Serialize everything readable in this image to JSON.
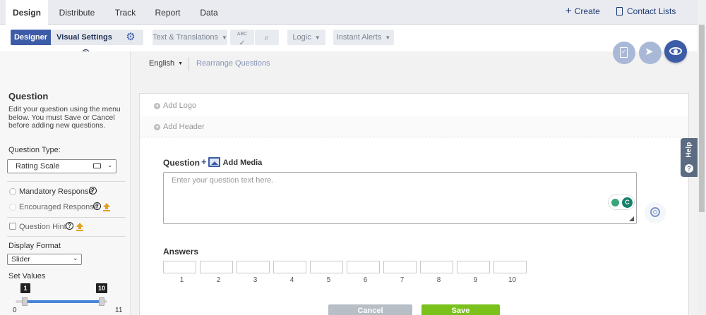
{
  "nav": {
    "tabs": [
      {
        "label": "Design",
        "active": true
      },
      {
        "label": "Distribute"
      },
      {
        "label": "Track"
      },
      {
        "label": "Report"
      },
      {
        "label": "Data"
      }
    ],
    "create_label": "Create",
    "contact_lists_label": "Contact Lists"
  },
  "toolbar": {
    "designer_label": "Designer",
    "visual_settings_label": "Visual Settings",
    "text_translations_label": "Text & Translations",
    "spellcheck_label": "ABC",
    "logic_label": "Logic",
    "instant_alerts_label": "Instant Alerts"
  },
  "lang": {
    "language": "English",
    "rearrange_label": "Rearrange Questions"
  },
  "left": {
    "title": "Question",
    "description": "Edit your question using the menu below. You must Save or Cancel before adding new questions.",
    "question_type_label": "Question Type:",
    "question_type_value": "Rating Scale",
    "mandatory_label": "Mandatory Response",
    "encouraged_label": "Encouraged Response",
    "hint_label": "Question Hint",
    "display_format_label": "Display Format",
    "display_format_value": "Slider",
    "set_values_label": "Set Values",
    "slider_min": "1",
    "slider_max": "10",
    "slider_scale_min": "0",
    "slider_scale_max": "11"
  },
  "editor": {
    "add_logo_label": "Add Logo",
    "add_header_label": "Add Header",
    "question_label": "Question",
    "add_media_label": "Add Media",
    "question_placeholder": "Enter your question text here.",
    "answers_label": "Answers",
    "answer_numbers": [
      "1",
      "2",
      "3",
      "4",
      "5",
      "6",
      "7",
      "8",
      "9",
      "10"
    ],
    "cancel_label": "Cancel",
    "save_label": "Save"
  },
  "help_label": "Help",
  "colors": {
    "primary": "#3d5ca8",
    "save_green": "#7ac11c",
    "cancel_grey": "#b7bec5",
    "slider_blue": "#4a86d8"
  }
}
